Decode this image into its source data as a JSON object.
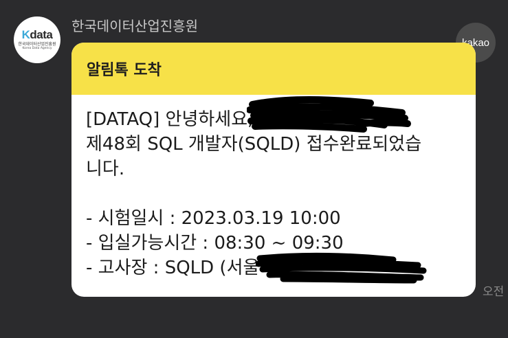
{
  "sender": {
    "name": "한국데이터산업진흥원",
    "logo_main": "data",
    "logo_k": "K",
    "logo_org": "한국데이터산업진흥원",
    "logo_en": "Korea Data Agency"
  },
  "badge": {
    "label": "kakao"
  },
  "message": {
    "header": "알림톡 도착",
    "lines": [
      "[DATAQ] 안녕하세요,",
      "제48회 SQL 개발자(SQLD) 접수완료되었습",
      "니다.",
      "",
      "- 시험일시 : 2023.03.19 10:00",
      "- 입실가능시간 : 08:30 ~ 09:30",
      "- 고사장 : SQLD (서울"
    ]
  },
  "time": "오전",
  "colors": {
    "background": "#2b2b2d",
    "header": "#f7e148",
    "bubble": "#ffffff"
  }
}
